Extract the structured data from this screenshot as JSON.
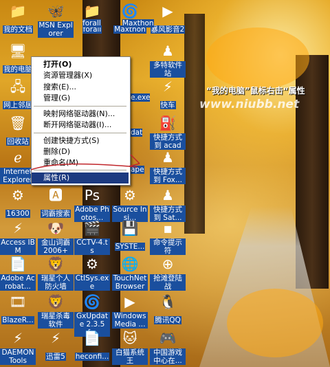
{
  "desktop_icons": [
    {
      "label": "我的文档",
      "glyph": "📁"
    },
    {
      "label": "MSN Explorer",
      "glyph": "🦋"
    },
    {
      "label": "forall",
      "glyph": "📁"
    },
    {
      "label": "Maxthon",
      "glyph": "🌀"
    },
    {
      "label": "暴风影音2",
      "glyph": "▶"
    },
    {
      "label": "我的电脑",
      "glyph": "🖥"
    },
    {
      "label": "多特软件站",
      "glyph": "♟"
    },
    {
      "label": "网上邻居",
      "glyph": "🖧"
    },
    {
      "label": "快车",
      "glyph": "⚡"
    },
    {
      "label": "回收站",
      "glyph": "🗑"
    },
    {
      "label": "快捷方式到 acad",
      "glyph": "⛽"
    },
    {
      "label": "Internet Explorer",
      "glyph": "ℯ"
    },
    {
      "label": "快捷方式到 Fox...",
      "glyph": "♟"
    },
    {
      "label": "16300",
      "glyph": "⚙"
    },
    {
      "label": "词霸搜索",
      "glyph": "🅰"
    },
    {
      "label": "Adobe Photos...",
      "glyph": "Ps"
    },
    {
      "label": "Source Insi...",
      "glyph": "⚙"
    },
    {
      "label": "快捷方式到 Sat...",
      "glyph": "♟"
    },
    {
      "label": "Access IBM",
      "glyph": "⚡"
    },
    {
      "label": "金山词霸 2006+",
      "glyph": "🐶"
    },
    {
      "label": "CCTV-4.ts",
      "glyph": "🎬"
    },
    {
      "label": "SYSTE...",
      "glyph": "💾"
    },
    {
      "label": "命令提示符",
      "glyph": "▪"
    },
    {
      "label": "Adobe Acrobat...",
      "glyph": "📄"
    },
    {
      "label": "瑞星个人防火墙",
      "glyph": "🦁"
    },
    {
      "label": "CtlSys.exe",
      "glyph": "⚙"
    },
    {
      "label": "TouchNet Browser",
      "glyph": "🌐"
    },
    {
      "label": "抢滩登陆战",
      "glyph": "⊕"
    },
    {
      "label": "BlazeR...",
      "glyph": "🎞"
    },
    {
      "label": "瑞星杀毒软件",
      "glyph": "🦁"
    },
    {
      "label": "GxUpdate 2.3.5 f...",
      "glyph": "🌀"
    },
    {
      "label": "Windows Media ...",
      "glyph": "▶"
    },
    {
      "label": "腾讯QQ",
      "glyph": "🐧"
    },
    {
      "label": "DAEMON Tools",
      "glyph": "⚡"
    },
    {
      "label": "迅雷5",
      "glyph": "⚡"
    },
    {
      "label": "heconfi...",
      "glyph": "📄"
    },
    {
      "label": "白猫系统王",
      "glyph": "🐱"
    },
    {
      "label": "中国游戏中心在...",
      "glyph": "🎮"
    }
  ],
  "partial_labels": [
    "forall",
    "Maxthon",
    "e.exe",
    "dat",
    "ape"
  ],
  "context_menu": {
    "items": [
      {
        "label": "打开(O)"
      },
      {
        "label": "资源管理器(X)"
      },
      {
        "label": "搜索(E)..."
      },
      {
        "label": "管理(G)"
      },
      {
        "label": "映射网络驱动器(N)..."
      },
      {
        "label": "断开网络驱动器(I)..."
      },
      {
        "label": "创建快捷方式(S)"
      },
      {
        "label": "删除(D)"
      },
      {
        "label": "重命名(M)"
      },
      {
        "label": "属性(R)"
      }
    ]
  },
  "annotation": "“我的电脑”鼠标右击“属性",
  "watermark": "www.niubb.net",
  "colors": {
    "label_bg": "#1a4f9e",
    "menu_highlight": "#1c3a80"
  }
}
